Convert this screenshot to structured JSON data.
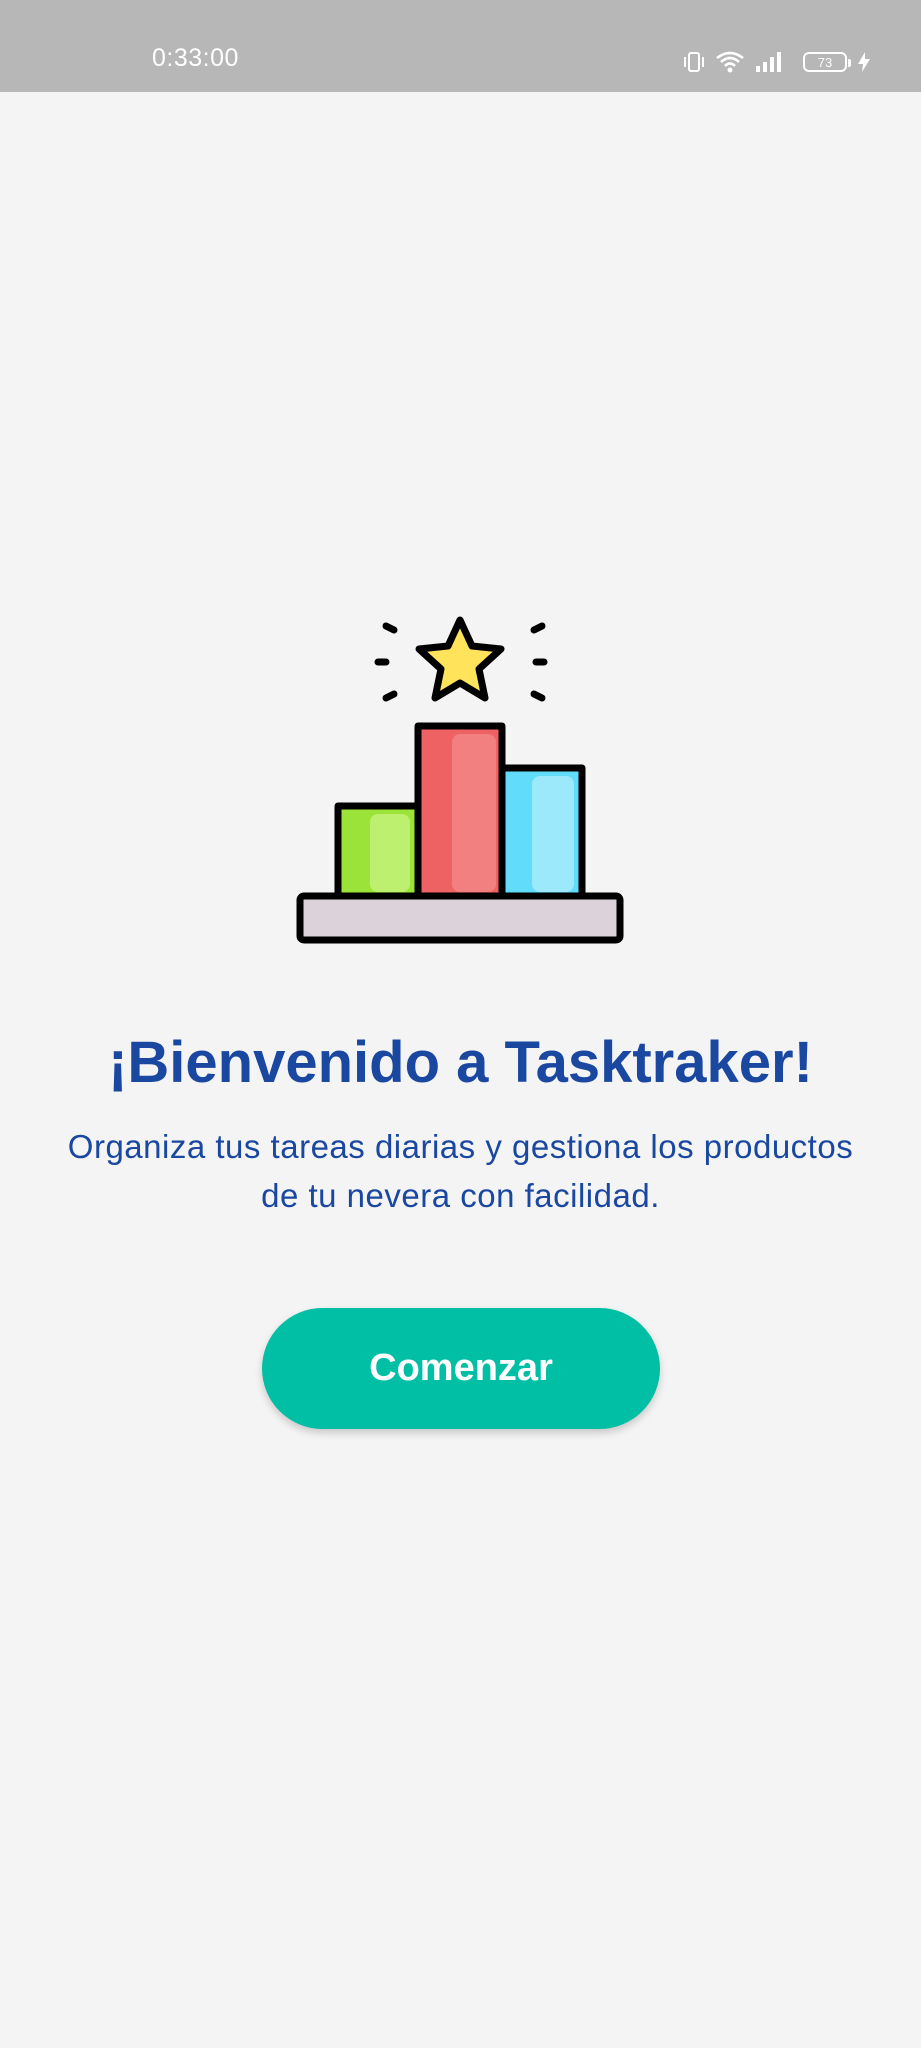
{
  "status_bar": {
    "time": "0:33:00",
    "battery_level": "73",
    "icons": [
      "vibrate-icon",
      "wifi-icon",
      "signal-icon",
      "battery-icon",
      "charging-icon"
    ]
  },
  "welcome": {
    "title": "¡Bienvenido a Tasktraker!",
    "subtitle_line1": "Organiza tus tareas diarias y gestiona los productos",
    "subtitle_line2": "de tu nevera con facilidad.",
    "start_label": "Comenzar"
  },
  "illustration": {
    "icon": "podium-chart-star-icon"
  },
  "colors": {
    "accent": "#00bfa5",
    "title": "#1a47a0",
    "background": "#f4f4f4",
    "status_bar": "#b7b7b7",
    "bar_green": "#9be339",
    "bar_red": "#ef6263",
    "bar_blue": "#62dcfb",
    "star": "#ffe35a",
    "podium": "#dcd2da"
  }
}
